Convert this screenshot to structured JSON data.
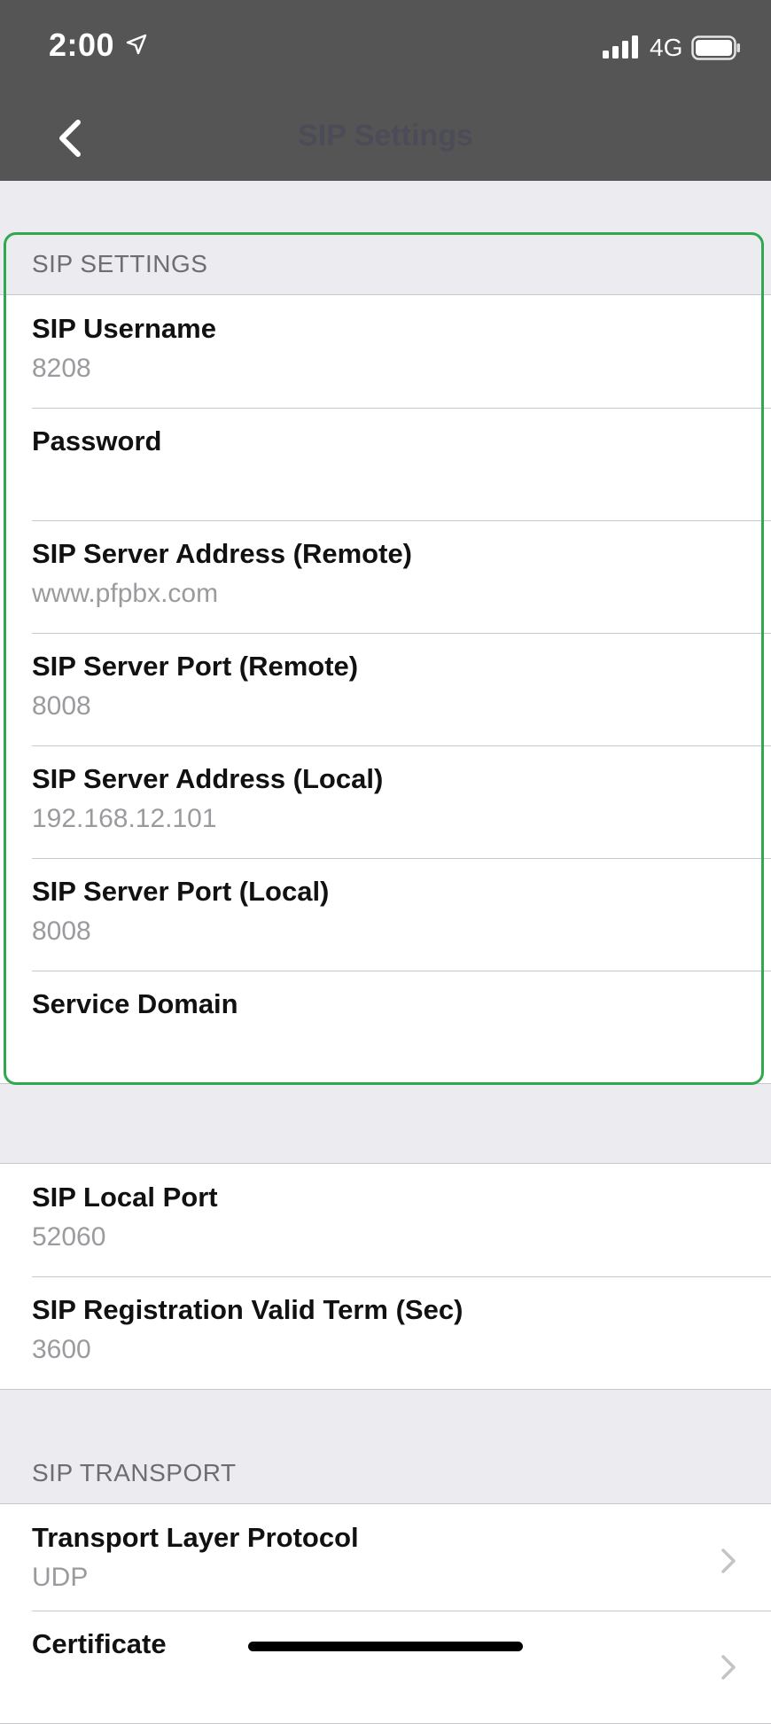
{
  "status_bar": {
    "time": "2:00",
    "network": "4G",
    "icons": [
      "location-arrow-icon",
      "signal-bars-icon",
      "battery-icon"
    ]
  },
  "nav": {
    "title": "SIP Settings",
    "back_icon": "chevron-left-icon"
  },
  "sip_settings": {
    "header": "SIP SETTINGS",
    "rows": [
      {
        "title": "SIP Username",
        "value": "8208"
      },
      {
        "title": "Password",
        "value": ""
      },
      {
        "title": "SIP Server Address (Remote)",
        "value": "www.pfpbx.com"
      },
      {
        "title": "SIP Server Port (Remote)",
        "value": "8008"
      },
      {
        "title": "SIP Server Address (Local)",
        "value": "192.168.12.101"
      },
      {
        "title": "SIP Server Port (Local)",
        "value": "8008"
      },
      {
        "title": "Service Domain",
        "value": ""
      }
    ]
  },
  "local_settings": {
    "rows": [
      {
        "title": "SIP Local Port",
        "value": "52060"
      },
      {
        "title": "SIP Registration Valid Term (Sec)",
        "value": "3600"
      }
    ]
  },
  "sip_transport": {
    "header": "SIP TRANSPORT",
    "rows": [
      {
        "title": "Transport Layer Protocol",
        "value": "UDP"
      },
      {
        "title": "Certificate",
        "value": ""
      }
    ]
  },
  "colors": {
    "status_bar_bg": "#555555",
    "page_bg": "#ebebf0",
    "highlight_border": "#2fa84f",
    "value_text": "#9b9b9f"
  }
}
